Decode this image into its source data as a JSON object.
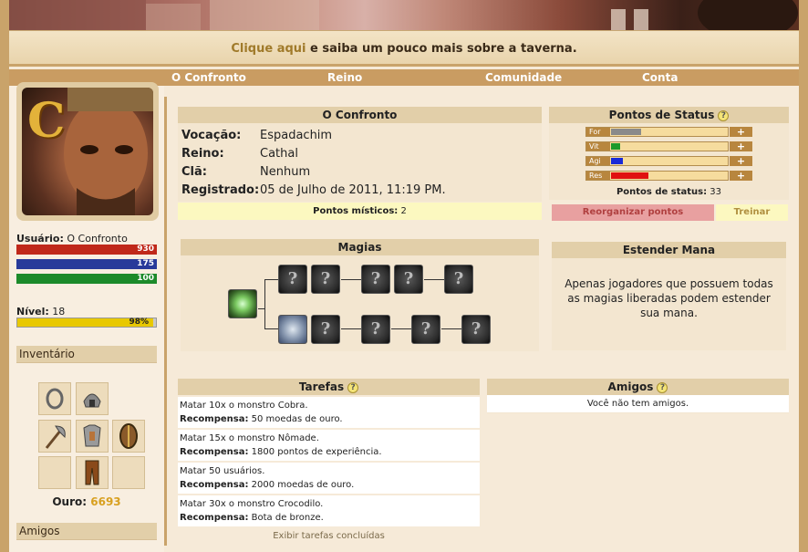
{
  "info_bar": {
    "link": "Clique aqui",
    "text": " e saiba um pouco mais sobre a taverna."
  },
  "nav": {
    "items": [
      "O Confronto",
      "Reino",
      "Comunidade",
      "Conta"
    ]
  },
  "sidebar": {
    "user_label": "Usuário:",
    "user_name": "O Confronto",
    "bars": [
      {
        "value": "930",
        "color": "#c0281a"
      },
      {
        "value": "175",
        "color": "#283a9a"
      },
      {
        "value": "100",
        "color": "#1c8a2a"
      }
    ],
    "level_label": "Nível:",
    "level": "18",
    "xp_percent": "98%",
    "xp_fraction": 0.98,
    "inventory_title": "Inventário",
    "gold_label": "Ouro:",
    "gold": "6693",
    "friends_title": "Amigos"
  },
  "profile": {
    "title": "O Confronto",
    "rows": [
      {
        "label": "Vocação:",
        "value": "Espadachim"
      },
      {
        "label": "Reino:",
        "value": "Cathal"
      },
      {
        "label": "Clã:",
        "value": "Nenhum"
      },
      {
        "label": "Registrado:",
        "value": "05 de Julho de 2011, 11:19 PM."
      }
    ],
    "mystic_label": "Pontos místicos:",
    "mystic_value": "2"
  },
  "status": {
    "title": "Pontos de Status",
    "stats": [
      {
        "label": "For",
        "fraction": 0.26,
        "color": "#8a8a8a"
      },
      {
        "label": "Vit",
        "fraction": 0.08,
        "color": "#1c9a2a"
      },
      {
        "label": "Agi",
        "fraction": 0.1,
        "color": "#1a2ad8"
      },
      {
        "label": "Res",
        "fraction": 0.32,
        "color": "#e01010"
      }
    ],
    "points_label": "Pontos de status:",
    "points": "33",
    "reorganize": "Reorganizar pontos",
    "train": "Treinar"
  },
  "magic": {
    "title": "Magias",
    "unknown": "?"
  },
  "mana": {
    "title": "Estender Mana",
    "text": "Apenas jogadores que possuem todas as magias liberadas podem estender sua mana."
  },
  "tasks": {
    "title": "Tarefas",
    "reward_label": "Recompensa:",
    "items": [
      {
        "task": "Matar 10x o monstro Cobra.",
        "reward": "50 moedas de ouro."
      },
      {
        "task": "Matar 15x o monstro Nômade.",
        "reward": "1800 pontos de experiência."
      },
      {
        "task": "Matar 50 usuários.",
        "reward": "2000 moedas de ouro."
      },
      {
        "task": "Matar 30x o monstro Crocodilo.",
        "reward": "Bota de bronze."
      }
    ],
    "completed_link": "Exibir tarefas concluídas"
  },
  "friends": {
    "title": "Amigos",
    "empty": "Você não tem amigos."
  }
}
